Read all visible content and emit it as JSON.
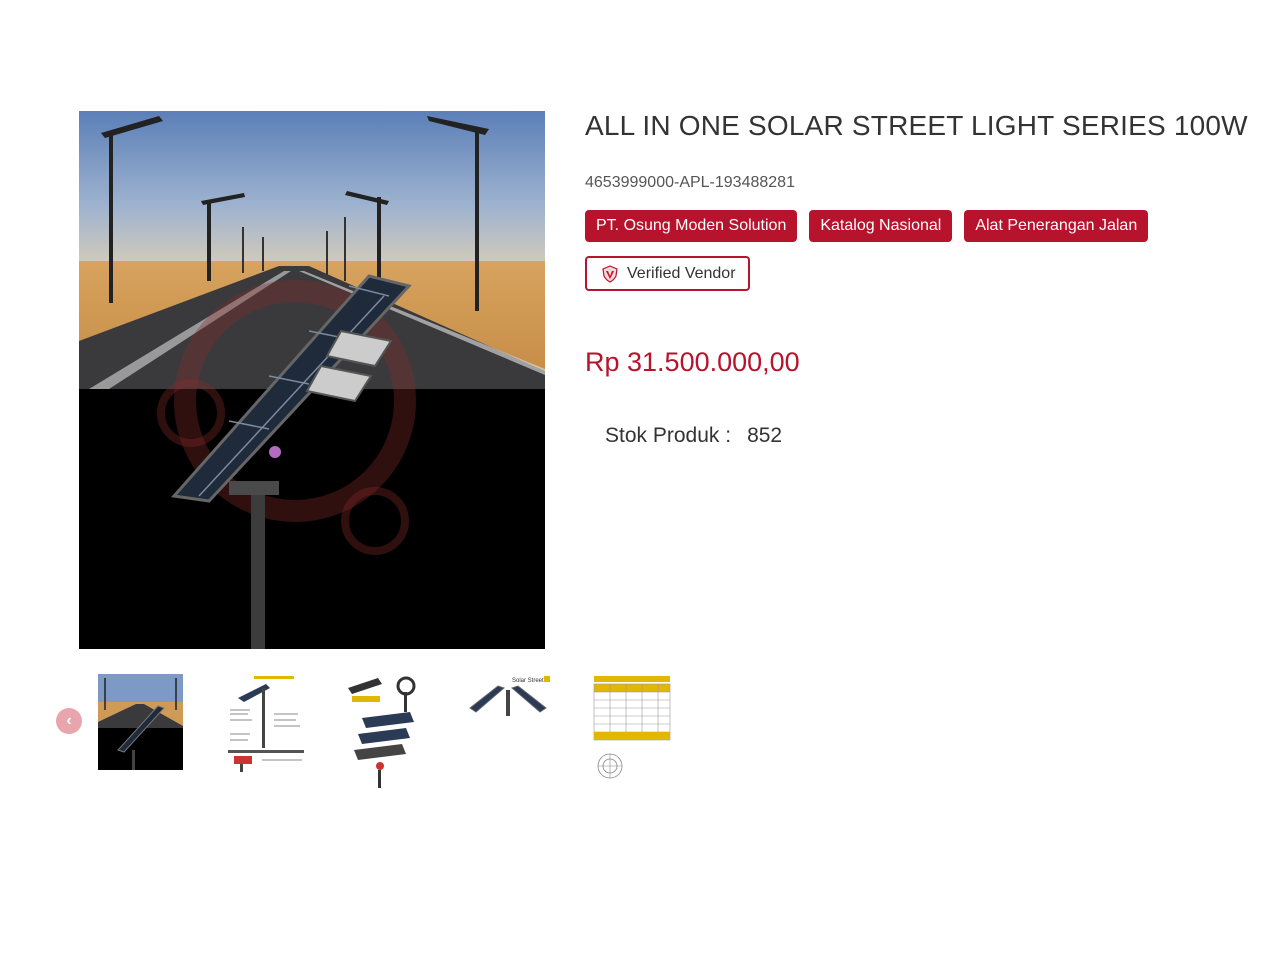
{
  "product": {
    "title": "ALL IN ONE SOLAR STREET LIGHT SERIES 100W",
    "sku": "4653999000-APL-193488281",
    "tags": [
      "PT. Osung Moden Solution",
      "Katalog Nasional",
      "Alat Penerangan Jalan"
    ],
    "verified_label": "Verified Vendor",
    "price": "Rp 31.500.000,00",
    "stock_label": "Stok Produk :",
    "stock_value": "852"
  },
  "gallery": {
    "prev_icon": "chevron-left-icon",
    "thumbnail_count": 5
  },
  "colors": {
    "accent": "#b7132c",
    "text": "#333333",
    "prev_button": "#e8a5ab"
  }
}
